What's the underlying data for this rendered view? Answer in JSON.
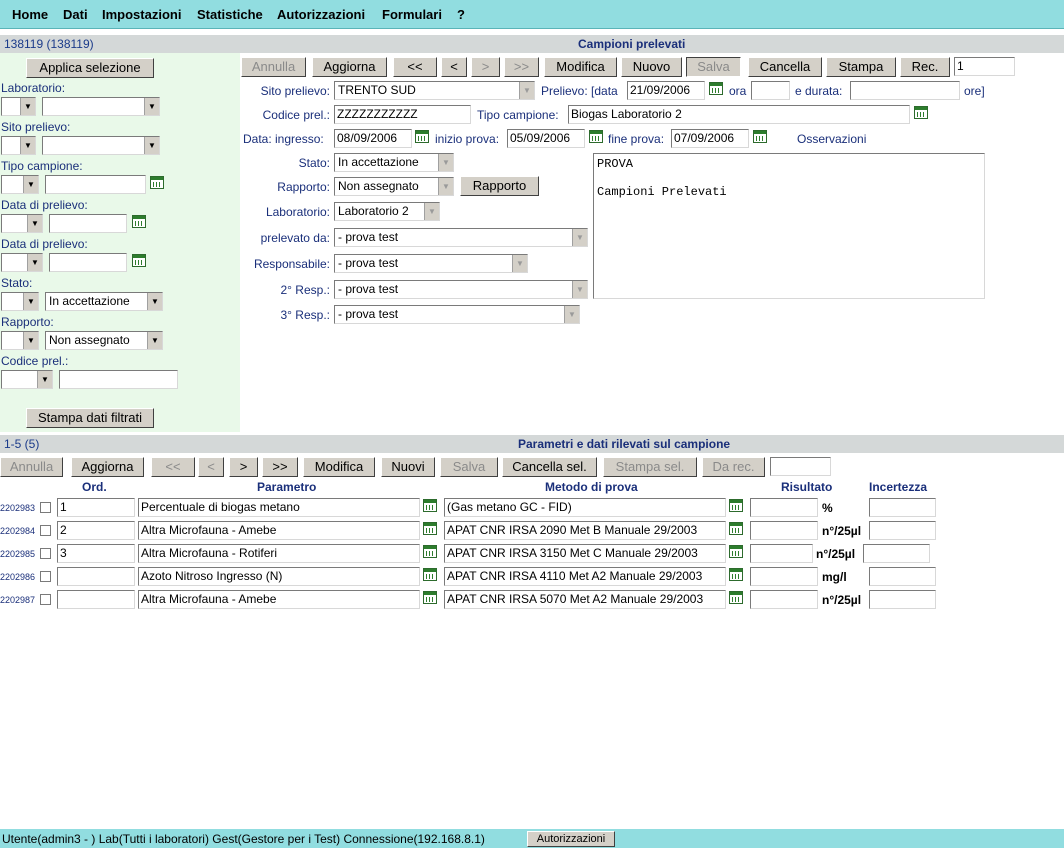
{
  "menu": [
    "Home",
    "Dati",
    "Impostazioni",
    "Statistiche",
    "Autorizzazioni",
    "Formulari",
    "?"
  ],
  "header": {
    "record_id": "138119 (138119)",
    "title": "Campioni prelevati"
  },
  "filter": {
    "apply_label": "Applica selezione",
    "laboratorio_label": "Laboratorio:",
    "sito_label": "Sito prelievo:",
    "tipo_label": "Tipo campione:",
    "data1_label": "Data di prelievo:",
    "data2_label": "Data di prelievo:",
    "stato_label": "Stato:",
    "stato_value": "In accettazione",
    "rapporto_label": "Rapporto:",
    "rapporto_value": "Non assegnato",
    "codice_label": "Codice prel.:",
    "print_label": "Stampa dati filtrati"
  },
  "toolbar": {
    "annulla": "Annulla",
    "aggiorna": "Aggiorna",
    "first": "<<",
    "prev": "<",
    "next": ">",
    "last": ">>",
    "modifica": "Modifica",
    "nuovo": "Nuovo",
    "salva": "Salva",
    "cancella": "Cancella",
    "stampa": "Stampa",
    "rec": "Rec.",
    "rec_value": "1"
  },
  "form": {
    "sito_label": "Sito prelievo:",
    "sito_value": "TRENTO SUD",
    "prelievo_label": "Prelievo: [data",
    "prelievo_data": "21/09/2006",
    "ora_label": "ora",
    "durata_label": "e durata:",
    "ore_label": "ore]",
    "codice_label": "Codice prel.:",
    "codice_value": "ZZZZZZZZZZZ",
    "tipo_label": "Tipo campione:",
    "tipo_value": "Biogas Laboratorio 2",
    "ingresso_label": "Data: ingresso:",
    "ingresso_value": "08/09/2006",
    "inizio_label": "inizio prova:",
    "inizio_value": "05/09/2006",
    "fine_label": "fine prova:",
    "fine_value": "07/09/2006",
    "osservazioni_label": "Osservazioni",
    "osservazioni_text": "PROVA\n\nCampioni Prelevati",
    "stato_label": "Stato:",
    "stato_value": "In accettazione",
    "rapporto_label": "Rapporto:",
    "rapporto_value": "Non assegnato",
    "rapporto_btn": "Rapporto",
    "lab_label": "Laboratorio:",
    "lab_value": "Laboratorio 2",
    "prelevato_label": "prelevato da:",
    "prelevato_value": "- prova test",
    "resp_label": "Responsabile:",
    "resp_value": "- prova test",
    "resp2_label": "2° Resp.:",
    "resp2_value": "- prova test",
    "resp3_label": "3° Resp.:",
    "resp3_value": "- prova test"
  },
  "params_header": {
    "count": "1-5 (5)",
    "title": "Parametri e dati rilevati sul campione"
  },
  "params_toolbar": {
    "annulla": "Annulla",
    "aggiorna": "Aggiorna",
    "first": "<<",
    "prev": "<",
    "next": ">",
    "last": ">>",
    "modifica": "Modifica",
    "nuovi": "Nuovi",
    "salva": "Salva",
    "cancella_sel": "Cancella sel.",
    "stampa_sel": "Stampa sel.",
    "da_rec": "Da rec."
  },
  "columns": {
    "ord": "Ord.",
    "parametro": "Parametro",
    "metodo": "Metodo di prova",
    "risultato": "Risultato",
    "incertezza": "Incertezza"
  },
  "rows": [
    {
      "id": "2202983",
      "ord": "1",
      "parametro": "Percentuale di biogas metano",
      "metodo": "(Gas metano GC - FID)",
      "unit": "%"
    },
    {
      "id": "2202984",
      "ord": "2",
      "parametro": "Altra Microfauna - Amebe",
      "metodo": "APAT CNR IRSA 2090 Met B Manuale 29/2003",
      "unit": "n°/25µl"
    },
    {
      "id": "2202985",
      "ord": "3",
      "parametro": "Altra Microfauna - Rotiferi",
      "metodo": "APAT CNR IRSA 3150 Met C Manuale 29/2003",
      "unit": "n°/25µl"
    },
    {
      "id": "2202986",
      "ord": "",
      "parametro": "Azoto Nitroso Ingresso (N)",
      "metodo": "APAT CNR IRSA 4110 Met A2 Manuale 29/2003",
      "unit": "mg/l"
    },
    {
      "id": "2202987",
      "ord": "",
      "parametro": "Altra Microfauna - Amebe",
      "metodo": "APAT CNR IRSA 5070 Met A2 Manuale 29/2003",
      "unit": "n°/25µl"
    }
  ],
  "status": {
    "text": "Utente(admin3 - ) Lab(Tutti i laboratori) Gest(Gestore per i Test) Connessione(192.168.8.1)",
    "button": "Autorizzazioni"
  }
}
